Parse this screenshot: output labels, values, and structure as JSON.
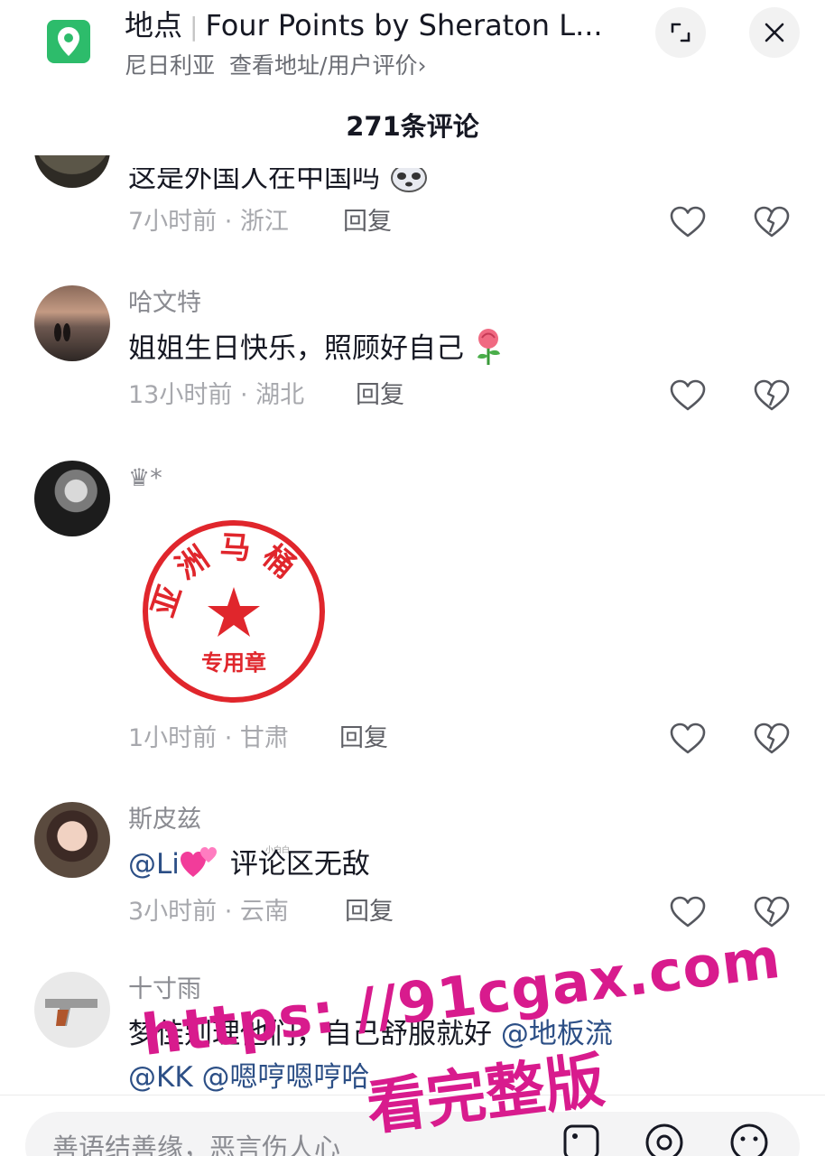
{
  "header": {
    "title_prefix": "地点",
    "title": "Four Points by Sheraton L...",
    "location": "尼日利亚",
    "address_link": "查看地址/用户评价",
    "chevron": "›",
    "icon": "location-pin-icon",
    "brand_color": "#2dbc6b"
  },
  "comment_count": "271条评论",
  "comments": [
    {
      "username": "",
      "text": "这是外国人在中国吗",
      "emoji": "panda-sticker-icon",
      "time": "7小时前 · 浙江",
      "reply": "回复"
    },
    {
      "username": "哈文特",
      "text": "姐姐生日快乐，照顾好自己",
      "emoji": "rose-icon",
      "time": "13小时前 · 湖北",
      "reply": "回复"
    },
    {
      "username": "♛*",
      "stamp": {
        "top": "亚洲马桶",
        "bottom": "专用章",
        "color": "#e0262c",
        "tag": "小白白"
      },
      "time": "1小时前 · 甘肃",
      "reply": "回复"
    },
    {
      "username": "斯皮兹",
      "mention": "@Li",
      "emoji": "pink-hearts-icon",
      "text": "评论区无敌",
      "time": "3小时前 · 云南",
      "reply": "回复"
    },
    {
      "username": "十寸雨",
      "text": "梦佳别理他们，自己舒服就好",
      "mention2": "@地板流",
      "line2": "@KK @嗯哼嗯哼哈"
    }
  ],
  "input": {
    "placeholder": "善语结善缘，恶言伤人心"
  },
  "watermark": {
    "url": "https: //91cgax.com",
    "label": "看完整版",
    "color": "#d81b8d"
  }
}
